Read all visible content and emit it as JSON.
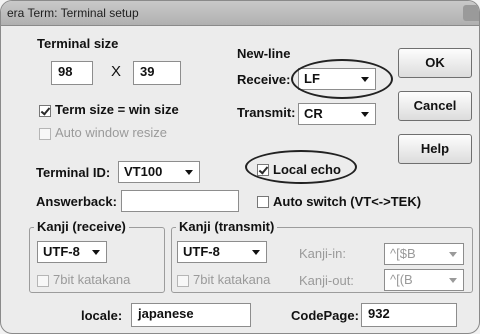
{
  "window": {
    "title": "era Term: Terminal setup"
  },
  "terminal_size": {
    "label": "Terminal size",
    "cols": "98",
    "separator": "X",
    "rows": "39",
    "term_size_eq_win_label": "Term size = win size",
    "term_size_eq_win_checked": true,
    "auto_resize_label": "Auto window resize",
    "auto_resize_checked": false
  },
  "newline": {
    "label": "New-line",
    "receive_label": "Receive:",
    "receive_value": "LF",
    "transmit_label": "Transmit:",
    "transmit_value": "CR"
  },
  "buttons": {
    "ok": "OK",
    "cancel": "Cancel",
    "help": "Help"
  },
  "terminal_id": {
    "label": "Terminal ID:",
    "value": "VT100"
  },
  "local_echo": {
    "label": "Local echo",
    "checked": true
  },
  "answerback": {
    "label": "Answerback:",
    "value": ""
  },
  "auto_switch": {
    "label": "Auto switch (VT<->TEK)",
    "checked": false
  },
  "kanji_receive": {
    "label": "Kanji (receive)",
    "value": "UTF-8",
    "katakana_label": "7bit katakana",
    "katakana_checked": false
  },
  "kanji_transmit": {
    "label": "Kanji (transmit)",
    "value": "UTF-8",
    "katakana_label": "7bit katakana",
    "katakana_checked": false,
    "kanji_in_label": "Kanji-in:",
    "kanji_in_value": "^[$B",
    "kanji_out_label": "Kanji-out:",
    "kanji_out_value": "^[(B"
  },
  "locale": {
    "label": "locale:",
    "value": "japanese"
  },
  "codepage": {
    "label": "CodePage:",
    "value": "932"
  }
}
